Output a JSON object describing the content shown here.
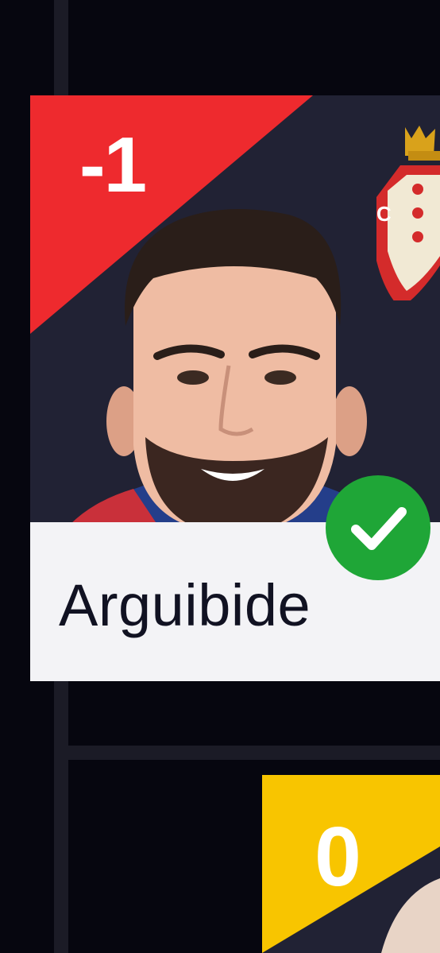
{
  "player_card": {
    "score": "-1",
    "score_color": "#ee2a2e",
    "player_name": "Arguibide",
    "status_icon": "checkmark-icon",
    "status_color": "#1fa637",
    "club_crest_icon": "club-crest-icon"
  },
  "next_card": {
    "score": "0",
    "score_color": "#f8c500"
  }
}
